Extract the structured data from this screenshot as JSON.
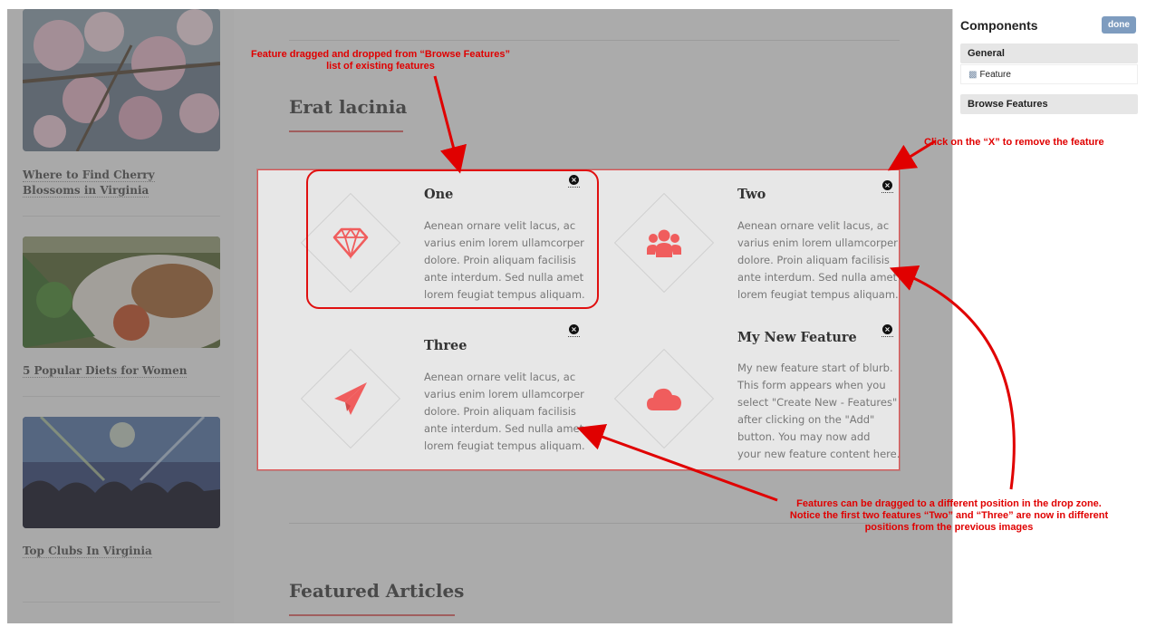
{
  "left_articles": [
    {
      "title": "Where to Find Cherry Blossoms in Virginia"
    },
    {
      "title": "5 Popular Diets for Women"
    },
    {
      "title": "Top Clubs In Virginia"
    }
  ],
  "main": {
    "section_heading": "Erat lacinia",
    "featured_heading": "Featured Articles"
  },
  "features": [
    {
      "title": "One",
      "text": "Aenean ornare velit lacus, ac\nvarius enim lorem ullamcorper\ndolore. Proin aliquam facilisis\nante interdum. Sed nulla amet\nlorem feugiat tempus aliquam.",
      "icon": "diamond-gem-icon",
      "remove": "×"
    },
    {
      "title": "Two",
      "text": "Aenean ornare velit lacus, ac\nvarius enim lorem ullamcorper\ndolore. Proin aliquam facilisis\nante interdum. Sed nulla amet\nlorem feugiat tempus aliquam.",
      "icon": "users-group-icon",
      "remove": "×"
    },
    {
      "title": "Three",
      "text": "Aenean ornare velit lacus, ac\nvarius enim lorem ullamcorper\ndolore. Proin aliquam facilisis\nante interdum. Sed nulla amet\nlorem feugiat tempus aliquam.",
      "icon": "paper-plane-icon",
      "remove": "×"
    },
    {
      "title": "My New Feature",
      "text": "My new feature start of blurb.\n This form appears when you\nselect \"Create New - Features\"\nafter clicking on the \"Add\"\nbutton.  You may now add\nyour new feature content here.",
      "icon": "cloud-icon",
      "remove": "×"
    }
  ],
  "panel": {
    "title": "Components",
    "done_label": "done",
    "general_label": "General",
    "feature_item": "Feature",
    "browse_label": "Browse Features"
  },
  "annotations": {
    "drag_from_browse": "Feature dragged and dropped from “Browse Features”\nlist of existing features",
    "click_x": "Click on the “X” to remove the feature",
    "reorder_note": "Features can be dragged to a different position in the drop zone.\nNotice the first two features “Two” and “Three” are now in different\npositions from the previous images"
  },
  "colors": {
    "accent": "#f05d5d",
    "annotation": "#e00000",
    "done_button": "#7e9cbf"
  }
}
